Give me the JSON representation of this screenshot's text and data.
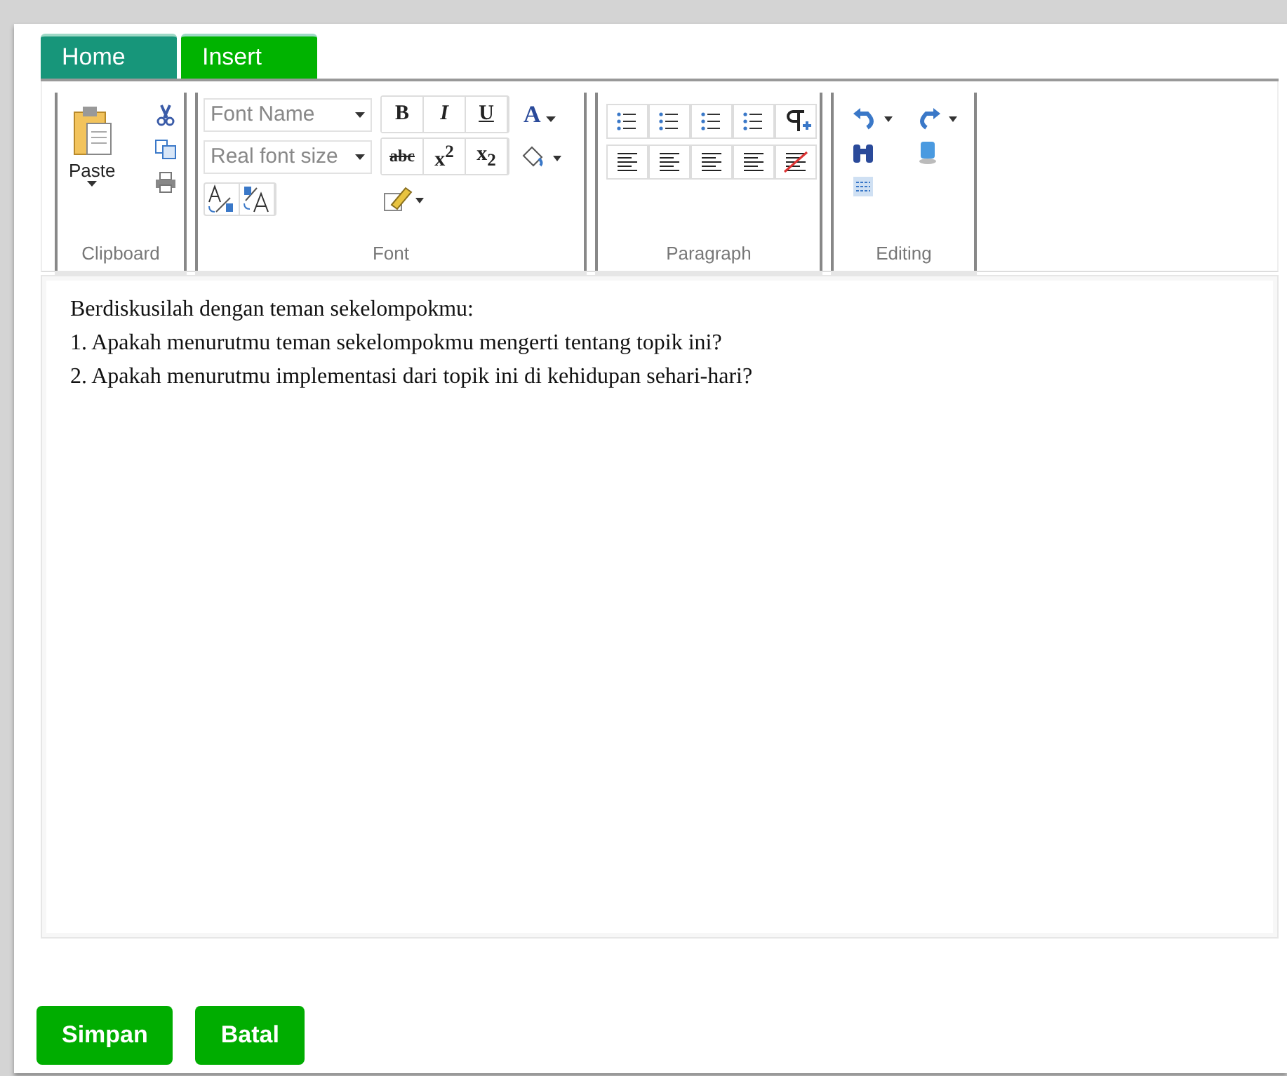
{
  "tabs": [
    {
      "label": "Home",
      "selected": false
    },
    {
      "label": "Insert",
      "selected": true
    }
  ],
  "ribbon": {
    "groups": [
      {
        "kind": "clipboard",
        "label": "Clipboard",
        "paste": "Paste"
      },
      {
        "kind": "font",
        "label": "Font",
        "font_name": "Font Name",
        "font_size": "Real font size",
        "styles": [
          "B",
          "I",
          "U"
        ],
        "scripts": [
          "abc",
          "x$^{2}$",
          "x$_{2}$"
        ],
        "color_letter": "A"
      },
      {
        "kind": "paragraph",
        "label": "Paragraph"
      },
      {
        "kind": "editing",
        "label": "Editing"
      }
    ]
  },
  "editor": {
    "lines": [
      "Berdiskusilah dengan teman sekelompokmu:",
      "1. Apakah menurutmu teman sekelompokmu mengerti tentang topik ini?",
      "2. Apakah menurutmu implementasi dari topik ini di kehidupan sehari-hari?"
    ]
  },
  "buttons": [
    "Simpan",
    "Batal"
  ]
}
